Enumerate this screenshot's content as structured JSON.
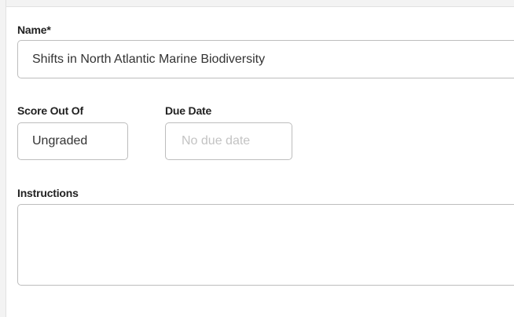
{
  "form": {
    "name": {
      "label": "Name*",
      "value": "Shifts in North Atlantic Marine Biodiversity"
    },
    "score": {
      "label": "Score Out Of",
      "value": "Ungraded"
    },
    "due_date": {
      "label": "Due Date",
      "placeholder": "No due date"
    },
    "instructions": {
      "label": "Instructions",
      "value": ""
    }
  }
}
